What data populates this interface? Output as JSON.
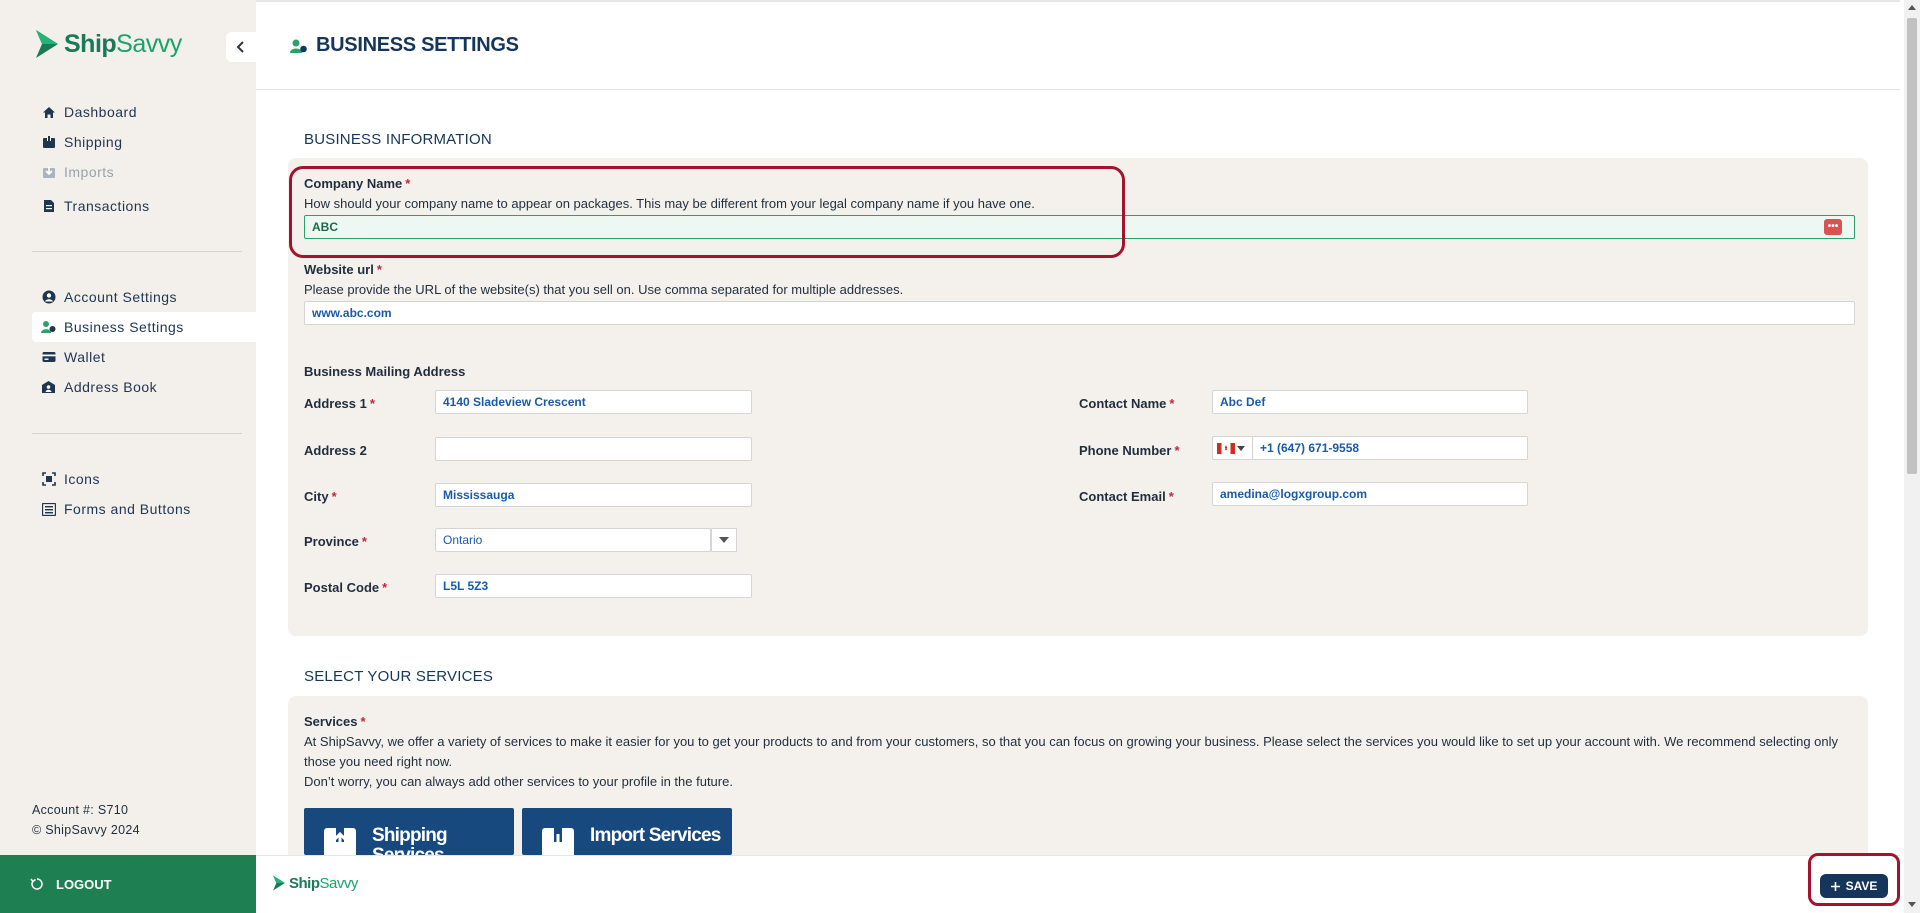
{
  "app": {
    "brand_ship": "Ship",
    "brand_savvy": "Savvy"
  },
  "sidebar": {
    "nav_main": [
      {
        "label": "Dashboard",
        "icon": "home-icon"
      },
      {
        "label": "Shipping",
        "icon": "box-icon"
      },
      {
        "label": "Imports",
        "icon": "import-icon",
        "disabled": true
      },
      {
        "label": "Transactions",
        "icon": "document-icon"
      }
    ],
    "nav_settings": [
      {
        "label": "Account Settings",
        "icon": "user-circle-icon"
      },
      {
        "label": "Business Settings",
        "icon": "business-users-icon",
        "active": true
      },
      {
        "label": "Wallet",
        "icon": "wallet-icon"
      },
      {
        "label": "Address Book",
        "icon": "address-book-icon"
      }
    ],
    "nav_dev": [
      {
        "label": "Icons",
        "icon": "scan-icon"
      },
      {
        "label": "Forms and Buttons",
        "icon": "list-icon"
      }
    ],
    "account_number": "Account #: S710",
    "copyright": "© ShipSavvy 2024",
    "logout_label": "LOGOUT"
  },
  "page": {
    "title": "BUSINESS SETTINGS"
  },
  "business_info": {
    "section_title": "BUSINESS INFORMATION",
    "company_name": {
      "label": "Company Name",
      "required": "*",
      "help": "How should your company name to appear on packages. This may be different from your legal company name if you have one.",
      "value": "ABC"
    },
    "website": {
      "label": "Website url",
      "required": "*",
      "help": "Please provide the URL of the website(s) that you sell on. Use comma separated for multiple addresses.",
      "value": "www.abc.com"
    },
    "mailing_title": "Business Mailing Address",
    "address1": {
      "label": "Address 1",
      "required": "*",
      "value": "4140 Sladeview Crescent"
    },
    "address2": {
      "label": "Address 2",
      "value": ""
    },
    "city": {
      "label": "City",
      "required": "*",
      "value": "Mississauga"
    },
    "province": {
      "label": "Province",
      "required": "*",
      "value": "Ontario"
    },
    "postal_code": {
      "label": "Postal Code",
      "required": "*",
      "value": "L5L 5Z3"
    },
    "contact_name": {
      "label": "Contact Name",
      "required": "*",
      "value": "Abc Def"
    },
    "phone": {
      "label": "Phone Number",
      "required": "*",
      "value": "+1 (647) 671-9558",
      "country": "CA"
    },
    "contact_email": {
      "label": "Contact Email",
      "required": "*",
      "value": "amedina@logxgroup.com"
    }
  },
  "services": {
    "section_title": "SELECT YOUR SERVICES",
    "label": "Services",
    "required": "*",
    "description_1": "At ShipSavvy, we offer a variety of services to make it easier for you to get your products to and from your customers, so that you can focus on growing your business. Please select the services you would like to set up your account with. We recommend selecting only those you need right now.",
    "description_2": "Don’t worry, you can always add other services to your profile in the future.",
    "tiles": [
      {
        "label": "Shipping Services"
      },
      {
        "label": "Import Services"
      }
    ]
  },
  "footer": {
    "save_label": "SAVE"
  },
  "colors": {
    "sidebar_bg": "#f3f0ec",
    "brand_green": "#1d7f52",
    "navy": "#15365a",
    "required_red": "#c0273b",
    "highlight_red": "#a5122d"
  }
}
